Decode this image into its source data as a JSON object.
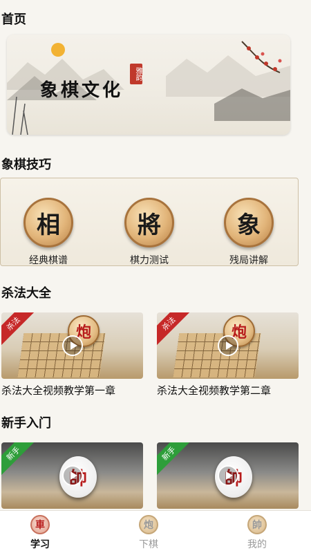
{
  "header": {
    "title": "首页"
  },
  "banner": {
    "title": "象棋文化",
    "seal": "雅韵"
  },
  "skills": {
    "title": "象棋技巧",
    "items": [
      {
        "glyph": "相",
        "label": "经典棋谱"
      },
      {
        "glyph": "將",
        "label": "棋力测试"
      },
      {
        "glyph": "象",
        "label": "残局讲解"
      }
    ]
  },
  "kill": {
    "title": "杀法大全",
    "tag": "杀法",
    "cards": [
      {
        "title": "杀法大全视频教学第一章",
        "piece": "炮"
      },
      {
        "title": "杀法大全视频教学第二章",
        "piece": "炮"
      }
    ]
  },
  "novice": {
    "title": "新手入门",
    "tag": "新手",
    "cards": [
      {
        "piece": "帥"
      },
      {
        "piece": "帥"
      }
    ]
  },
  "tabbar": {
    "items": [
      {
        "glyph": "車",
        "label": "学习",
        "active": true
      },
      {
        "glyph": "炮",
        "label": "下棋",
        "active": false
      },
      {
        "glyph": "帥",
        "label": "我的",
        "active": false
      }
    ]
  },
  "colors": {
    "accent": "#c62828",
    "novice_tag": "#2e9e3a",
    "background": "#f7f5f0"
  }
}
